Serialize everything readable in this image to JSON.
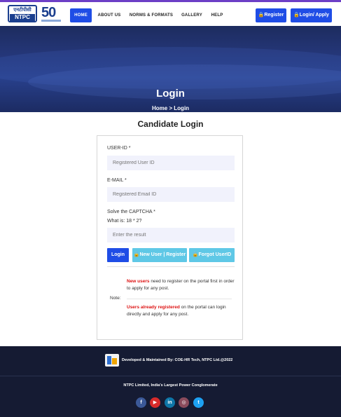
{
  "brand": {
    "hindi": "एनटीपीसी",
    "name": "NTPC",
    "anniversary": "50"
  },
  "nav": {
    "home": "HOME",
    "about": "ABOUT US",
    "norms": "NORMS & FORMATS",
    "gallery": "GALLERY",
    "help": "HELP",
    "register": "Register",
    "login_apply": "Login/ Apply"
  },
  "hero": {
    "title": "Login",
    "breadcrumb": "Home > Login"
  },
  "form": {
    "title": "Candidate Login",
    "userid_label": "USER-ID *",
    "userid_placeholder": "Registered User ID",
    "email_label": "E-MAIL *",
    "email_placeholder": "Registered Email ID",
    "captcha_label": "Solve the CAPTCHA *",
    "captcha_question": "What is: 18 * 2?",
    "captcha_placeholder": "Enter the result",
    "login_button": "Login",
    "new_user_button": "New User | Register",
    "forgot_button": "Forgot UserID"
  },
  "note": {
    "label": "Note:",
    "new_users_highlight": "New users",
    "new_users_text": " need to register on the portal first in order to apply for any post.",
    "registered_highlight": "Users already registered",
    "registered_text": " on the portal can login directly and apply for any post."
  },
  "footer": {
    "developed": "Developed & Maintained By:  COE-HR Tech, NTPC Ltd.@2022",
    "tagline": "NTPC Limited, India's Largest Power Conglomerate",
    "social": [
      "f",
      "▶",
      "in",
      "◎",
      "t"
    ]
  },
  "colors": {
    "primary": "#1f4de6",
    "light_button": "#5fc8e6",
    "footer_bg": "#151b33",
    "alert_red": "#dd1111",
    "facebook": "#3b5998",
    "youtube": "#d72b2b",
    "linkedin": "#0e76a8",
    "instagram": "#8a4b5c",
    "twitter": "#1da1f2"
  }
}
